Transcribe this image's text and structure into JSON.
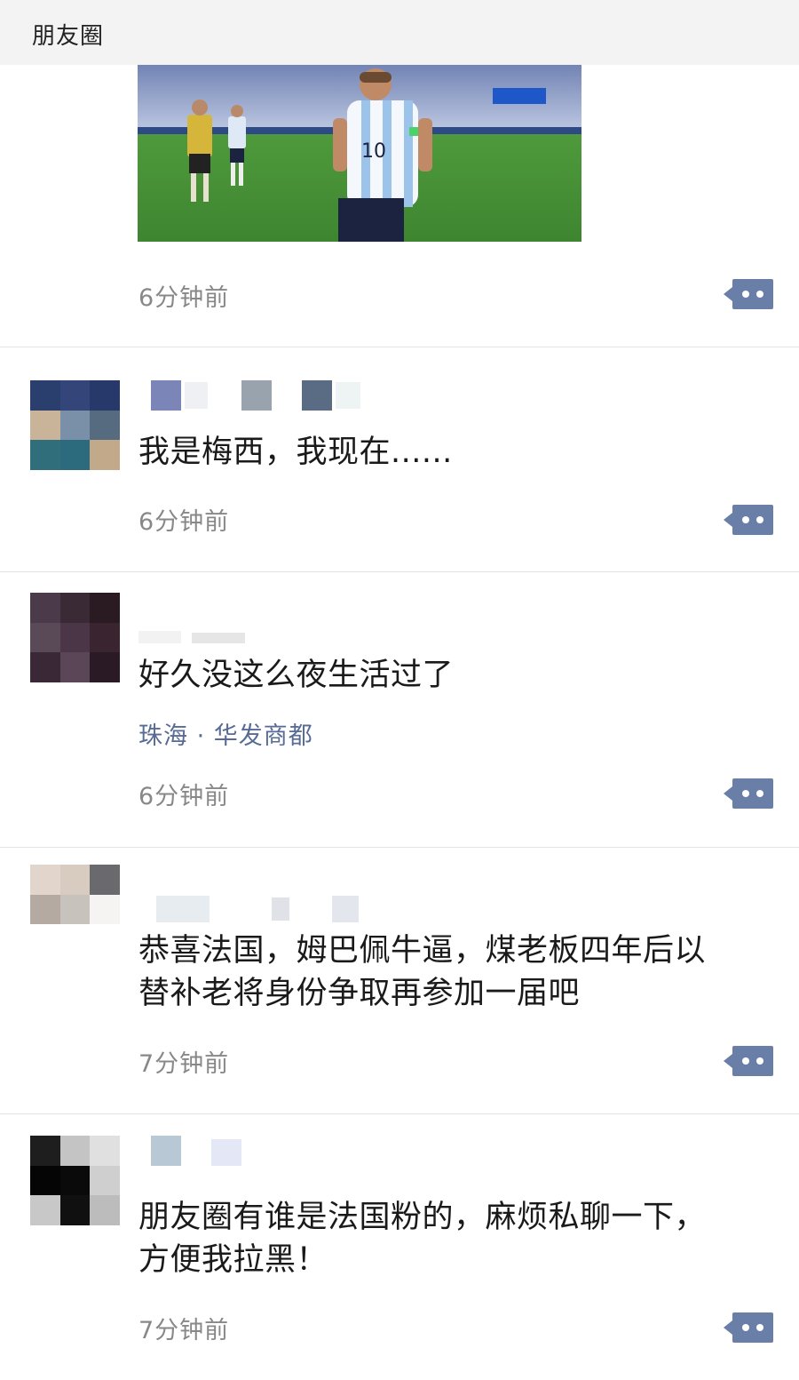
{
  "header": {
    "title": "朋友圈"
  },
  "posts": [
    {
      "time": "6分钟前"
    },
    {
      "content": "我是梅西，我现在......",
      "time": "6分钟前"
    },
    {
      "content": "好久没这么夜生活过了",
      "location": "珠海 · 华发商都",
      "time": "6分钟前"
    },
    {
      "content_line1": "恭喜法国，姆巴佩牛逼，煤老板四年后以",
      "content_line2": "替补老将身份争取再参加一届吧",
      "time": "7分钟前"
    },
    {
      "content_line1": "朋友圈有谁是法国粉的，麻烦私聊一下，",
      "content_line2": "方便我拉黑！",
      "time": "7分钟前"
    }
  ],
  "photo": {
    "jersey_number": "10"
  },
  "icons": {
    "more": "more-dots-icon"
  },
  "colors": {
    "link": "#576b95",
    "button": "#6a7fa8",
    "time": "#888888"
  }
}
